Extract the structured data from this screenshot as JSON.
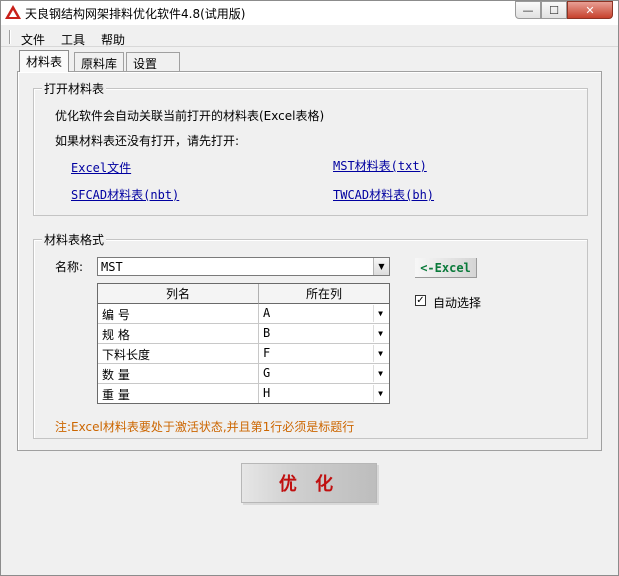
{
  "window": {
    "title": "天良钢结构网架排料优化软件4.8(试用版)",
    "controls": [
      "minimize",
      "maximize",
      "close"
    ]
  },
  "menu": {
    "items": [
      "文件",
      "工具",
      "帮助"
    ]
  },
  "tabs": [
    {
      "label": "材料表",
      "active": true
    },
    {
      "label": "原料库",
      "active": false
    },
    {
      "label": "设置",
      "active": false
    }
  ],
  "open_group": {
    "title": "打开材料表",
    "line1": "优化软件会自动关联当前打开的材料表(Excel表格)",
    "line2": "如果材料表还没有打开，请先打开:",
    "links": {
      "excel": "Excel文件",
      "mst": "MST材料表(txt)",
      "sfcad": "SFCAD材料表(nbt)",
      "twcad": "TWCAD材料表(bh)"
    }
  },
  "format_group": {
    "title": "材料表格式",
    "name_label": "名称:",
    "name_value": "MST",
    "excel_button": "<-Excel",
    "auto_select_label": "自动选择",
    "auto_select_checked": true,
    "columns_header": [
      "列名",
      "所在列"
    ],
    "rows": [
      {
        "name": "编 号",
        "col": "A"
      },
      {
        "name": "规 格",
        "col": "B"
      },
      {
        "name": "下料长度",
        "col": "F"
      },
      {
        "name": "数 量",
        "col": "G"
      },
      {
        "name": "重 量",
        "col": "H"
      }
    ],
    "note": "注:Excel材料表要处于激活状态,并且第1行必须是标题行"
  },
  "optimize_button": "优 化",
  "colors": {
    "link": "#0000a0",
    "note": "#cc6600",
    "excel_button_text": "#0a7a3a",
    "optimize_text": "#c01010",
    "close_button": "#c7412c"
  },
  "icons": {
    "app_logo": "red-triangle-logo-icon",
    "dropdown": "chevron-down-icon",
    "checkmark": "checkmark-icon"
  }
}
